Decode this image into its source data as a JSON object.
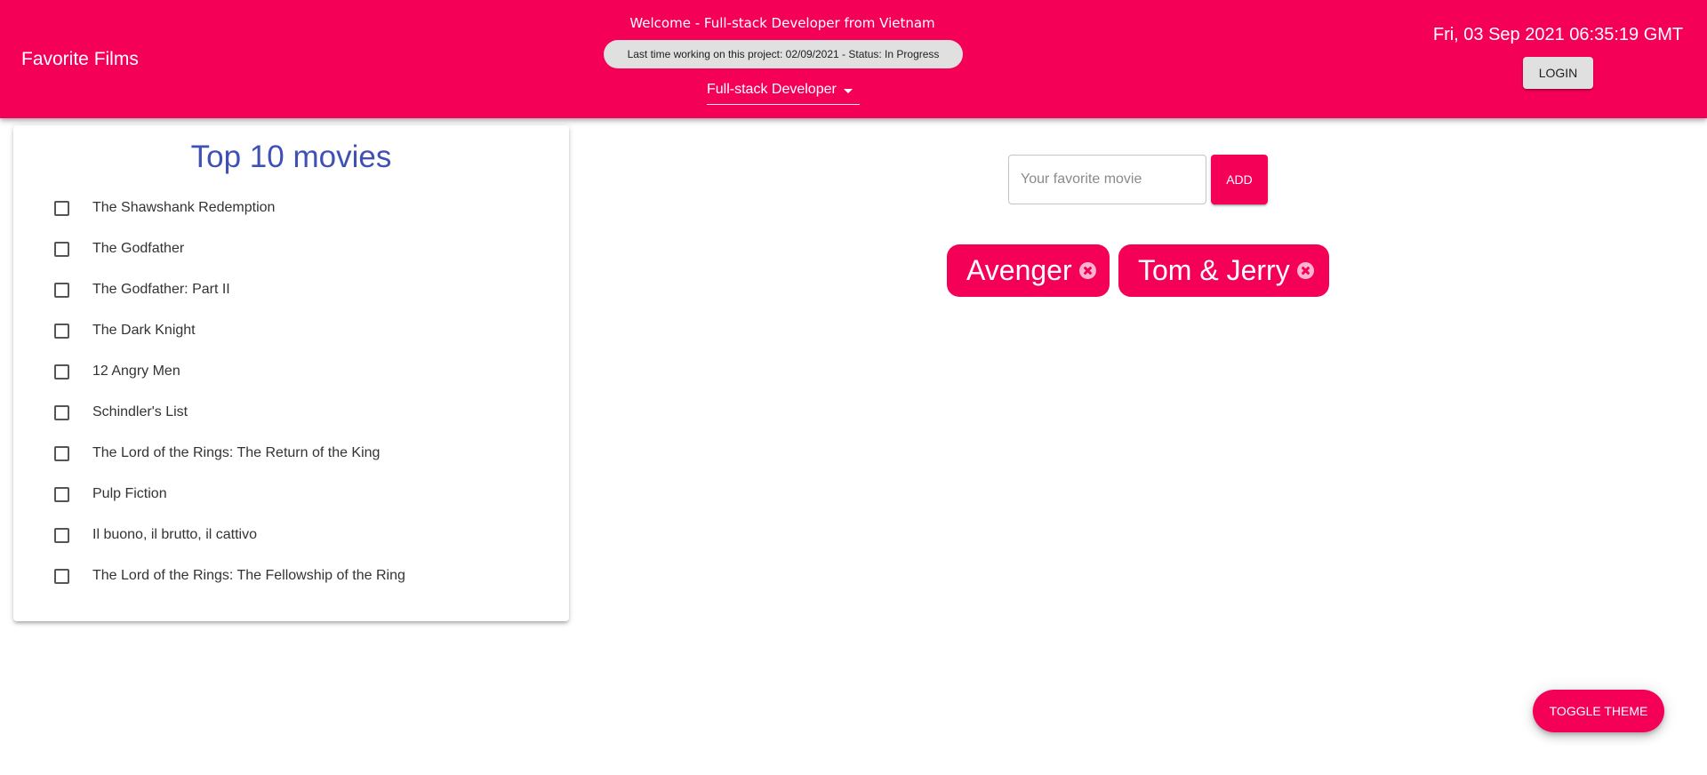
{
  "header": {
    "title": "Favorite Films",
    "welcome": "Welcome - Full-stack Developer from Vietnam",
    "status": "Last time working on this project: 02/09/2021 - Status: In Progress",
    "role_select": "Full-stack Developer",
    "datetime": "Fri, 03 Sep 2021 06:35:19 GMT",
    "login_label": "LOGIN"
  },
  "top_movies": {
    "title": "Top 10 movies",
    "items": [
      {
        "label": "The Shawshank Redemption",
        "checked": false
      },
      {
        "label": "The Godfather",
        "checked": false
      },
      {
        "label": "The Godfather: Part II",
        "checked": false
      },
      {
        "label": "The Dark Knight",
        "checked": false
      },
      {
        "label": "12 Angry Men",
        "checked": false
      },
      {
        "label": "Schindler's List",
        "checked": false
      },
      {
        "label": "The Lord of the Rings: The Return of the King",
        "checked": false
      },
      {
        "label": "Pulp Fiction",
        "checked": false
      },
      {
        "label": "Il buono, il brutto, il cattivo",
        "checked": false
      },
      {
        "label": "The Lord of the Rings: The Fellowship of the Ring",
        "checked": false
      }
    ]
  },
  "add_form": {
    "placeholder": "Your favorite movie",
    "value": "",
    "add_label": "ADD"
  },
  "favorites": [
    {
      "label": "Avenger",
      "delete_icon": "cancel-circle-icon"
    },
    {
      "label": "Tom & Jerry",
      "delete_icon": "cancel-circle-icon"
    }
  ],
  "toggle_theme_label": "TOGGLE THEME",
  "colors": {
    "primary": "#f50057",
    "title_blue": "#3f51b5",
    "chip_grey": "#e0e0e0"
  }
}
